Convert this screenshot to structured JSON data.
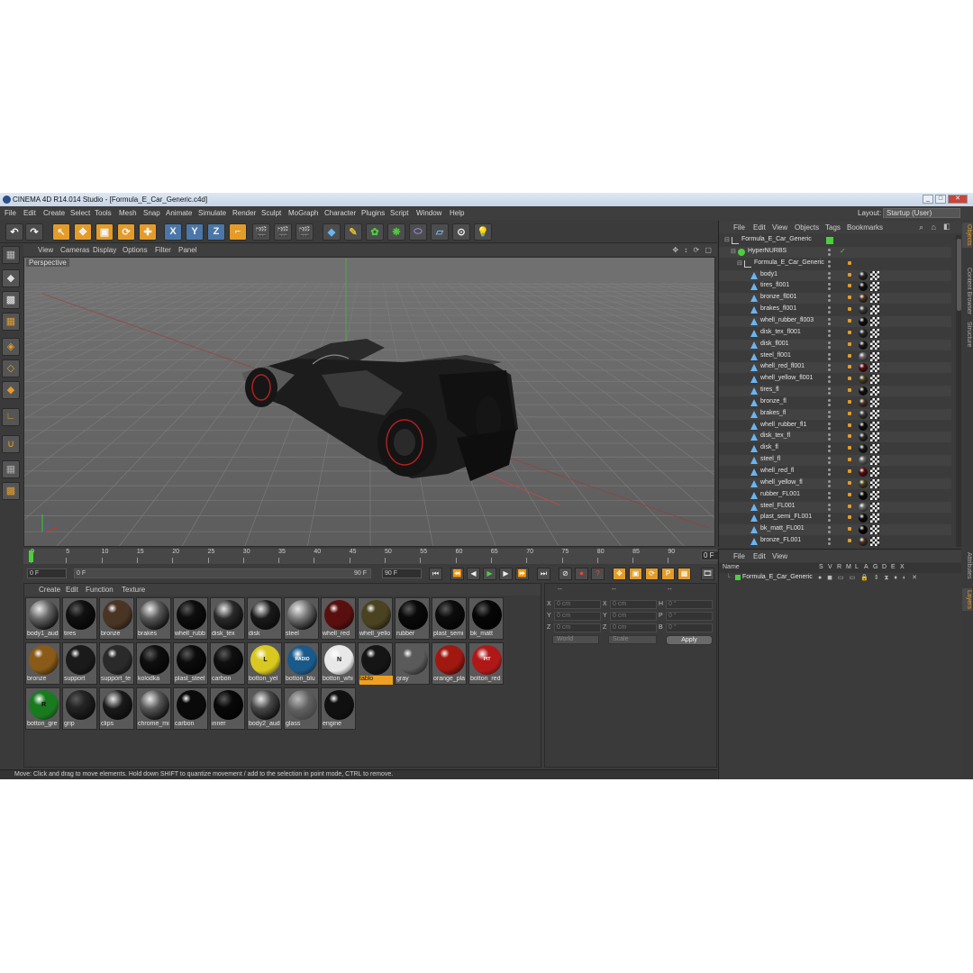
{
  "window": {
    "title": "CINEMA 4D R14.014 Studio - [Formula_E_Car_Generic.c4d]",
    "btn_min": "_",
    "btn_max": "□",
    "btn_close": "✕"
  },
  "menu": [
    "File",
    "Edit",
    "Create",
    "Select",
    "Tools",
    "Mesh",
    "Snap",
    "Animate",
    "Simulate",
    "Render",
    "Sculpt",
    "MoGraph",
    "Character",
    "Plugins",
    "Script",
    "Window",
    "Help"
  ],
  "layout": {
    "label": "Layout:",
    "value": "Startup (User)"
  },
  "viewport": {
    "menu": [
      "View",
      "Cameras",
      "Display",
      "Options",
      "Filter",
      "Panel"
    ],
    "label": "Perspective",
    "icons": "✥ ↕ ⟳ ▢"
  },
  "timeline": {
    "ticks": [
      "0",
      "5",
      "10",
      "15",
      "20",
      "25",
      "30",
      "35",
      "40",
      "45",
      "50",
      "55",
      "60",
      "65",
      "70",
      "75",
      "80",
      "85",
      "90"
    ],
    "current": "0 F",
    "start": "0 F",
    "range_start": "0 F",
    "range_end": "90 F",
    "end": "90 F"
  },
  "material_manager": {
    "menu": [
      "Create",
      "Edit",
      "Function",
      "Texture"
    ],
    "materials": [
      {
        "name": "body1_aud",
        "color": "#6a6a6a",
        "style": "env"
      },
      {
        "name": "tires",
        "color": "#111111",
        "style": "dark"
      },
      {
        "name": "bronze",
        "color": "#4a3524",
        "style": "spec"
      },
      {
        "name": "brakes",
        "color": "#5a5a5a",
        "style": "env"
      },
      {
        "name": "whell_rubb",
        "color": "#0e0e0e",
        "style": "dark"
      },
      {
        "name": "disk_tex",
        "color": "#2a2a2a",
        "style": "env"
      },
      {
        "name": "disk",
        "color": "#1a1a1a",
        "style": "env"
      },
      {
        "name": "steel",
        "color": "#7a7a7a",
        "style": "env"
      },
      {
        "name": "whell_red",
        "color": "#5a0f0f",
        "style": "spec"
      },
      {
        "name": "whell_yello",
        "color": "#4a4220",
        "style": "spec"
      },
      {
        "name": "rubber",
        "color": "#0a0a0a",
        "style": "dark"
      },
      {
        "name": "plast_semi",
        "color": "#0c0c0c",
        "style": "dark"
      },
      {
        "name": "bk_matt",
        "color": "#060606",
        "style": "dark"
      },
      {
        "name": "bronze",
        "color": "#8a5a18",
        "style": "spec"
      },
      {
        "name": "support",
        "color": "#1a1a1a",
        "style": "spec"
      },
      {
        "name": "support_te",
        "color": "#2a2a2a",
        "style": "spec"
      },
      {
        "name": "kolodka",
        "color": "#0f0f0f",
        "style": "dark"
      },
      {
        "name": "plast_steel",
        "color": "#0c0c0c",
        "style": "dark"
      },
      {
        "name": "carbon",
        "color": "#101010",
        "style": "dark"
      },
      {
        "name": "botton_yel",
        "color": "#d8c820",
        "style": "badge",
        "badge": "L",
        "badge_color": "#111"
      },
      {
        "name": "botton_blu",
        "color": "#1a5a8a",
        "style": "badge",
        "badge": "RADIO",
        "badge_color": "#fff"
      },
      {
        "name": "botton_whi",
        "color": "#e8e8e8",
        "style": "badge",
        "badge": "N",
        "badge_color": "#111"
      },
      {
        "name": "tablo",
        "color": "#151515",
        "style": "spec",
        "selected": true
      },
      {
        "name": "gray",
        "color": "#5a5a5a",
        "style": "spec"
      },
      {
        "name": "orange_pla",
        "color": "#a01810",
        "style": "spec"
      },
      {
        "name": "botton_red",
        "color": "#b01818",
        "style": "badge",
        "badge": "PIT",
        "badge_color": "#fff"
      },
      {
        "name": "botton_gre",
        "color": "#1a7a20",
        "style": "badge",
        "badge": "R",
        "badge_color": "#111"
      },
      {
        "name": "grip",
        "color": "#252525",
        "style": "dark"
      },
      {
        "name": "clips",
        "color": "#1a1a1a",
        "style": "env"
      },
      {
        "name": "chrome_mi",
        "color": "#5a5a5a",
        "style": "env"
      },
      {
        "name": "carbon",
        "color": "#0a0a0a",
        "style": "spec"
      },
      {
        "name": "inner",
        "color": "#080808",
        "style": "dark"
      },
      {
        "name": "body2_aud",
        "color": "#4a4a4a",
        "style": "env"
      },
      {
        "name": "glass",
        "color": "#606060",
        "style": "glass"
      },
      {
        "name": "engine",
        "color": "#101010",
        "style": "spec"
      }
    ]
  },
  "coordinates": {
    "headers": [
      "--",
      "--",
      "--"
    ],
    "rows": [
      {
        "a": "X",
        "av": "0 cm",
        "b": "X",
        "bv": "0 cm",
        "c": "H",
        "cv": "0 °"
      },
      {
        "a": "Y",
        "av": "0 cm",
        "b": "Y",
        "bv": "0 cm",
        "c": "P",
        "cv": "0 °"
      },
      {
        "a": "Z",
        "av": "0 cm",
        "b": "Z",
        "bv": "0 cm",
        "c": "B",
        "cv": "0 °"
      }
    ],
    "mode1": "World",
    "mode2": "Scale",
    "apply": "Apply"
  },
  "status": "Move: Click and drag to move elements. Hold down SHIFT to quantize movement / add to the selection in point mode, CTRL to remove.",
  "object_manager": {
    "menu": [
      "File",
      "Edit",
      "View",
      "Objects",
      "Tags",
      "Bookmarks"
    ],
    "objects": [
      {
        "name": "Formula_E_Car_Generic",
        "level": 0,
        "type": "null"
      },
      {
        "name": "HyperNURBS",
        "level": 1,
        "type": "nurbs"
      },
      {
        "name": "Formula_E_Car_Generic",
        "level": 2,
        "type": "null"
      },
      {
        "name": "body1",
        "level": 3,
        "type": "poly",
        "tag": "#2a2a2a"
      },
      {
        "name": "tires_fl001",
        "level": 3,
        "type": "poly",
        "tag": "#111"
      },
      {
        "name": "bronze_fl001",
        "level": 3,
        "type": "poly",
        "tag": "#4a3524"
      },
      {
        "name": "brakes_fl001",
        "level": 3,
        "type": "poly",
        "tag": "#3a3a3a"
      },
      {
        "name": "whell_rubber_fl003",
        "level": 3,
        "type": "poly",
        "tag": "#0e0e0e"
      },
      {
        "name": "disk_tex_fl001",
        "level": 3,
        "type": "poly",
        "tag": "#2a2a2a"
      },
      {
        "name": "disk_fl001",
        "level": 3,
        "type": "poly",
        "tag": "#1a1a1a"
      },
      {
        "name": "steel_fl001",
        "level": 3,
        "type": "poly",
        "tag": "#6a6a6a"
      },
      {
        "name": "whell_red_fl001",
        "level": 3,
        "type": "poly",
        "tag": "#5a0f0f"
      },
      {
        "name": "whell_yellow_fl001",
        "level": 3,
        "type": "poly",
        "tag": "#4a4220"
      },
      {
        "name": "tires_fl",
        "level": 3,
        "type": "poly",
        "tag": "#111"
      },
      {
        "name": "bronze_fl",
        "level": 3,
        "type": "poly",
        "tag": "#4a3524"
      },
      {
        "name": "brakes_fl",
        "level": 3,
        "type": "poly",
        "tag": "#3a3a3a"
      },
      {
        "name": "whell_rubber_fl1",
        "level": 3,
        "type": "poly",
        "tag": "#0e0e0e"
      },
      {
        "name": "disk_tex_fl",
        "level": 3,
        "type": "poly",
        "tag": "#2a2a2a"
      },
      {
        "name": "disk_fl",
        "level": 3,
        "type": "poly",
        "tag": "#1a1a1a"
      },
      {
        "name": "steel_fl",
        "level": 3,
        "type": "poly",
        "tag": "#6a6a6a"
      },
      {
        "name": "whell_red_fl",
        "level": 3,
        "type": "poly",
        "tag": "#5a0f0f"
      },
      {
        "name": "whell_yellow_fl",
        "level": 3,
        "type": "poly",
        "tag": "#4a4220"
      },
      {
        "name": "rubber_FL001",
        "level": 3,
        "type": "poly",
        "tag": "#0a0a0a"
      },
      {
        "name": "steel_FL001",
        "level": 3,
        "type": "poly",
        "tag": "#6a6a6a"
      },
      {
        "name": "plast_semi_FL001",
        "level": 3,
        "type": "poly",
        "tag": "#0c0c0c"
      },
      {
        "name": "bk_matt_FL001",
        "level": 3,
        "type": "poly",
        "tag": "#060606"
      },
      {
        "name": "bronze_FL001",
        "level": 3,
        "type": "poly",
        "tag": "#4a3524"
      }
    ]
  },
  "attribute_manager": {
    "menu": [
      "File",
      "Edit",
      "View"
    ],
    "columns": [
      "Name",
      "S",
      "V",
      "R",
      "M",
      "L",
      "A",
      "G",
      "D",
      "E",
      "X"
    ],
    "row": "Formula_E_Car_Generic"
  },
  "side_tabs": [
    "Objects",
    "Content Browser",
    "Structure"
  ],
  "side_tabs_lower": [
    "Attributes",
    "Layers"
  ],
  "colors": {
    "accent": "#e39c2a",
    "viewport_bg": "#6f6f6f",
    "panel_bg": "#3b3b3b"
  }
}
